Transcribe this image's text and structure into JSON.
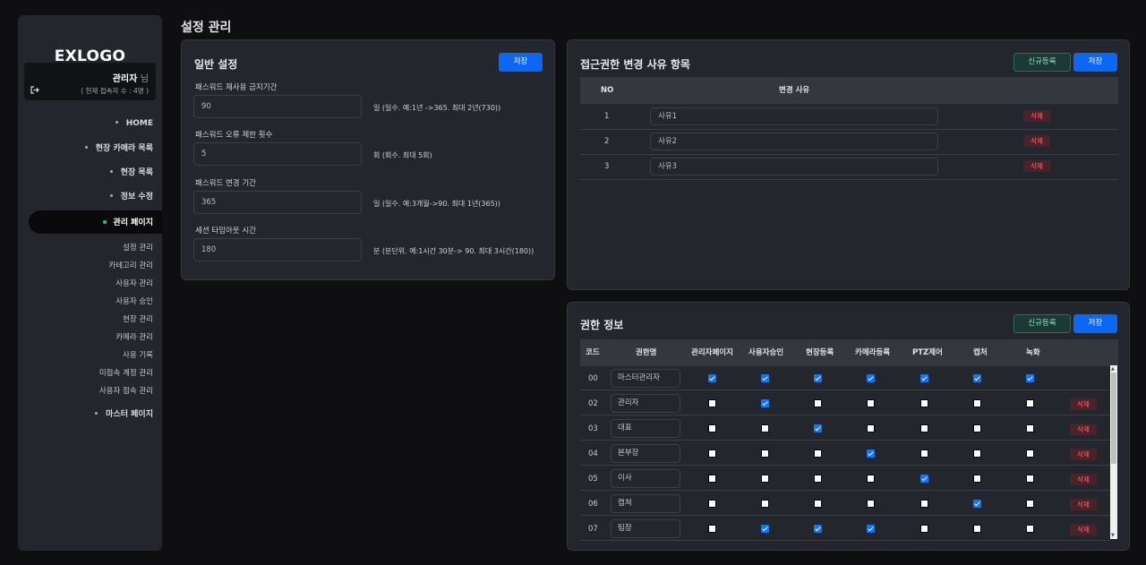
{
  "logo": "EXLOGO",
  "user": {
    "name": "관리자",
    "suffix": "님",
    "status": "( 현재 접속자 수 : 4명 )"
  },
  "nav": {
    "items": [
      "HOME",
      "현장 카메라 목록",
      "현장 목록",
      "정보 수정"
    ],
    "active": "관리 페이지",
    "sub_items": [
      "설정 관리",
      "카테고리 관리",
      "사용자 관리",
      "사용자 승인",
      "현장 관리",
      "카메라 관리",
      "사용 기록",
      "미접속 계정 관리",
      "사용자 접속 관리"
    ],
    "last": "마스터 페이지"
  },
  "page_title": "설정 관리",
  "general": {
    "title": "일반 설정",
    "save_label": "저장",
    "fields": [
      {
        "label": "패스워드 재사용 금지기간",
        "value": "90",
        "hint": "일 (일수. 예:1년 ->365. 최대 2년(730))"
      },
      {
        "label": "패스워드 오류 제한 횟수",
        "value": "5",
        "hint": "회 (회수. 최대 5회)"
      },
      {
        "label": "패스워드 변경 기간",
        "value": "365",
        "hint": "일 (일수. 예:3개월->90. 최대 1년(365))"
      },
      {
        "label": "세션 타임아웃 시간",
        "value": "180",
        "hint": "분 (분단위. 예:1시간 30분-> 90. 최대 3시간(180))"
      }
    ]
  },
  "reasons": {
    "title": "접근권한 변경 사유 항목",
    "new_label": "신규등록",
    "save_label": "저장",
    "columns": {
      "no": "NO",
      "reason": "변경 사유"
    },
    "delete_label": "삭제",
    "rows": [
      {
        "no": "1",
        "reason": "사유1"
      },
      {
        "no": "2",
        "reason": "사유2"
      },
      {
        "no": "3",
        "reason": "사유3"
      }
    ]
  },
  "permissions": {
    "title": "권한 정보",
    "new_label": "신규등록",
    "save_label": "저장",
    "delete_label": "삭제",
    "columns": [
      "코드",
      "권한명",
      "관리자페이지",
      "사용자승인",
      "현장등록",
      "카메라등록",
      "PTZ제어",
      "캡처",
      "녹화"
    ],
    "rows": [
      {
        "code": "00",
        "name": "마스터관리자",
        "perms": [
          true,
          true,
          true,
          true,
          true,
          true,
          true
        ],
        "deletable": false
      },
      {
        "code": "02",
        "name": "관리자",
        "perms": [
          false,
          true,
          false,
          false,
          false,
          false,
          false
        ],
        "deletable": true
      },
      {
        "code": "03",
        "name": "대표",
        "perms": [
          false,
          false,
          true,
          false,
          false,
          false,
          false
        ],
        "deletable": true
      },
      {
        "code": "04",
        "name": "본부장",
        "perms": [
          false,
          false,
          false,
          true,
          false,
          false,
          false
        ],
        "deletable": true
      },
      {
        "code": "05",
        "name": "이사",
        "perms": [
          false,
          false,
          false,
          false,
          true,
          false,
          false
        ],
        "deletable": true
      },
      {
        "code": "06",
        "name": "캡쳐",
        "perms": [
          false,
          false,
          false,
          false,
          false,
          true,
          false
        ],
        "deletable": true
      },
      {
        "code": "07",
        "name": "팀장",
        "perms": [
          false,
          true,
          true,
          true,
          false,
          false,
          false
        ],
        "deletable": true
      }
    ]
  },
  "colors": {
    "accent": "#0d67f5",
    "active_dot": "#27c280",
    "delete": "#ff6b78",
    "panel": "#24262d"
  }
}
